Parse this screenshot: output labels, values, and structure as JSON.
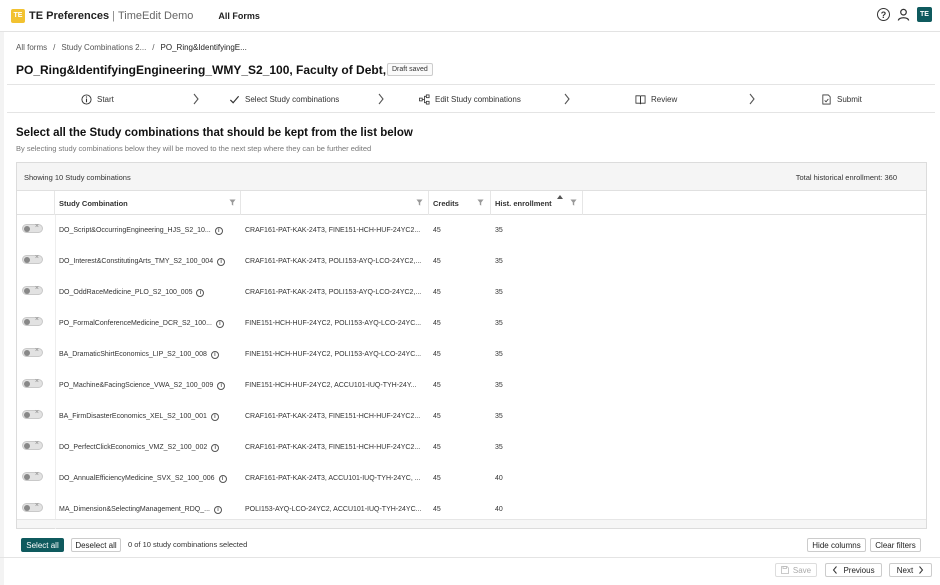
{
  "app": {
    "logo_text": "TE",
    "title": "TE Preferences",
    "separator": "|",
    "subtitle": "TimeEdit Demo",
    "nav_all_forms": "All Forms",
    "avatar_initials": "TE",
    "help_glyph": "?"
  },
  "breadcrumb": {
    "items": [
      "All forms",
      "/",
      "Study Combinations 2...",
      "/",
      "PO_Ring&IdentifyingE..."
    ]
  },
  "header": {
    "title": "PO_Ring&IdentifyingEngineering_WMY_S2_100, Faculty of Debt, 100",
    "badge": "Draft saved"
  },
  "steps": [
    {
      "label": "Start",
      "icon": "info-circle-icon"
    },
    {
      "label": "Select Study combinations",
      "icon": "check-icon"
    },
    {
      "label": "Edit Study combinations",
      "icon": "tree-icon"
    },
    {
      "label": "Review",
      "icon": "book-icon"
    },
    {
      "label": "Submit",
      "icon": "document-check-icon"
    }
  ],
  "section": {
    "title": "Select all the Study combinations that should be kept from the list below",
    "description": "By selecting study combinations below they will be moved to the next step where they can be further edited"
  },
  "table": {
    "showing": "Showing 10 Study combinations",
    "total": "Total historical enrollment: 360",
    "columns": [
      "Study Combination",
      "",
      "Credits",
      "Hist. enrollment"
    ],
    "rows": [
      {
        "name": "DO_Script&OccurringEngineering_HJS_S2_10...",
        "courses": "CRAF161-PAT-KAK-24T3, FINE151-HCH-HUF-24YC2...",
        "credits": "45",
        "enrollment": "35"
      },
      {
        "name": "DO_Interest&ConstitutingArts_TMY_S2_100_004",
        "courses": "CRAF161-PAT-KAK-24T3, POLI153-AYQ-LCO-24YC2,...",
        "credits": "45",
        "enrollment": "35"
      },
      {
        "name": "DO_OddRaceMedicine_PLO_S2_100_005",
        "courses": "CRAF161-PAT-KAK-24T3, POLI153-AYQ-LCO-24YC2,...",
        "credits": "45",
        "enrollment": "35"
      },
      {
        "name": "PO_FormalConferenceMedicine_DCR_S2_100...",
        "courses": "FINE151-HCH-HUF-24YC2, POLI153-AYQ-LCO-24YC...",
        "credits": "45",
        "enrollment": "35"
      },
      {
        "name": "BA_DramaticShirtEconomics_LIP_S2_100_008",
        "courses": "FINE151-HCH-HUF-24YC2, POLI153-AYQ-LCO-24YC...",
        "credits": "45",
        "enrollment": "35"
      },
      {
        "name": "PO_Machine&FacingScience_VWA_S2_100_009",
        "courses": "FINE151-HCH-HUF-24YC2, ACCU101-IUQ-TYH-24Y...",
        "credits": "45",
        "enrollment": "35"
      },
      {
        "name": "BA_FirmDisasterEconomics_XEL_S2_100_001",
        "courses": "CRAF161-PAT-KAK-24T3, FINE151-HCH-HUF-24YC2...",
        "credits": "45",
        "enrollment": "35"
      },
      {
        "name": "DO_PerfectClickEconomics_VMZ_S2_100_002",
        "courses": "CRAF161-PAT-KAK-24T3, FINE151-HCH-HUF-24YC2...",
        "credits": "45",
        "enrollment": "35"
      },
      {
        "name": "DO_AnnualEfficiencyMedicine_SVX_S2_100_006",
        "courses": "CRAF161-PAT-KAK-24T3, ACCU101-IUQ-TYH-24YC, ...",
        "credits": "45",
        "enrollment": "40"
      },
      {
        "name": "MA_Dimension&SelectingManagement_RDQ_...",
        "courses": "POLI153-AYQ-LCO-24YC2, ACCU101-IUQ-TYH-24YC...",
        "credits": "45",
        "enrollment": "40"
      }
    ]
  },
  "actions": {
    "select_all": "Select all",
    "deselect_all": "Deselect all",
    "selected_count": "0 of 10 study combinations selected",
    "hide_columns": "Hide columns",
    "clear_filters": "Clear filters"
  },
  "footer": {
    "save": "Save",
    "previous": "Previous",
    "next": "Next"
  },
  "colors": {
    "accent": "#0f5a5e",
    "logo": "#f2c230"
  }
}
